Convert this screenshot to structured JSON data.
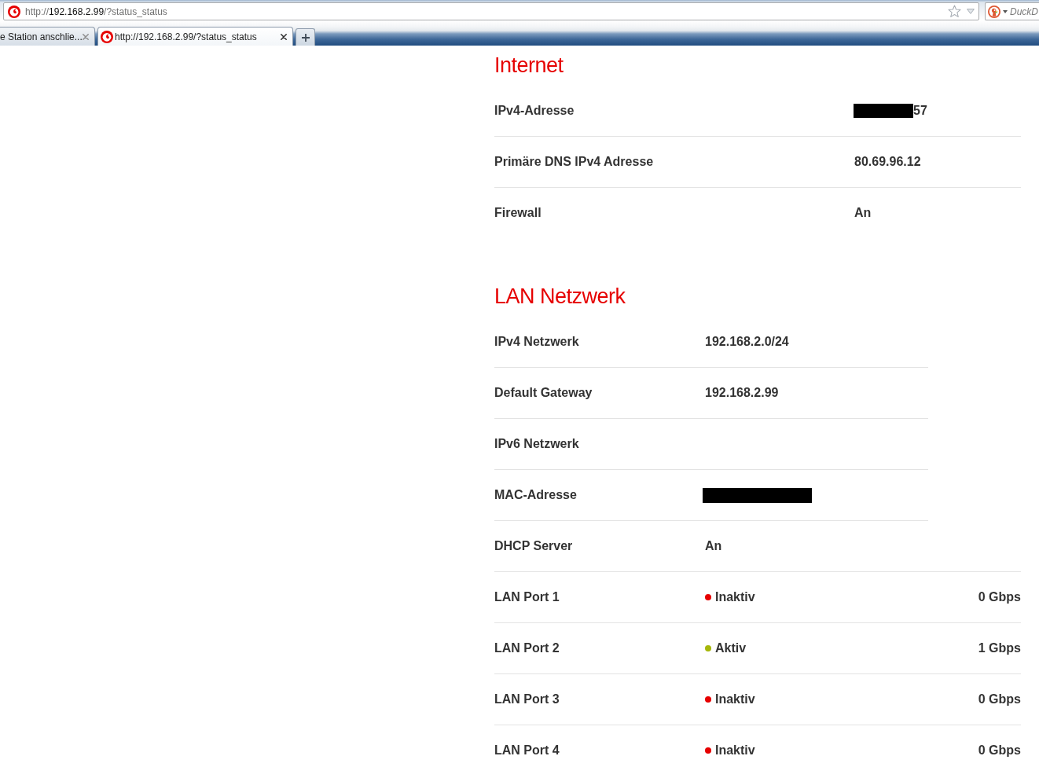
{
  "browser": {
    "address_bar": {
      "url": {
        "scheme": "http://",
        "host": "192.168.2.99",
        "path": "/?status_status"
      }
    },
    "search_field": {
      "placeholder": "DuckD"
    },
    "tabs": [
      {
        "title": "e Station anschlie...",
        "selected": false,
        "favicon": false
      },
      {
        "title": "http://192.168.2.99/?status_status",
        "selected": true,
        "favicon": true
      }
    ]
  },
  "sections": [
    {
      "title": "Internet",
      "rows": [
        {
          "kind": "field",
          "label": "IPv4-Adresse",
          "value": "57",
          "redacted": true
        },
        {
          "kind": "field",
          "label": "Primäre DNS IPv4 Adresse",
          "value": "80.69.96.12",
          "redacted": false
        },
        {
          "kind": "field",
          "label": "Firewall",
          "value": "An",
          "redacted": false
        }
      ]
    },
    {
      "title": "LAN Netzwerk",
      "rows": [
        {
          "kind": "field",
          "label": "IPv4 Netzwerk",
          "value": "192.168.2.0/24",
          "redacted": false
        },
        {
          "kind": "field",
          "label": "Default Gateway",
          "value": "192.168.2.99",
          "redacted": false
        },
        {
          "kind": "field",
          "label": "IPv6 Netzwerk",
          "redacted": false
        },
        {
          "kind": "field",
          "label": "MAC-Adresse",
          "redacted": true
        },
        {
          "kind": "field",
          "label": "DHCP Server",
          "value": "An",
          "redacted": false
        },
        {
          "kind": "port",
          "label": "LAN Port 1",
          "status": "Inaktiv",
          "color": "#e60000",
          "speed": "0 Gbps"
        },
        {
          "kind": "port",
          "label": "LAN Port 2",
          "status": "Aktiv",
          "color": "#a6b70a",
          "speed": "1 Gbps"
        },
        {
          "kind": "port",
          "label": "LAN Port 3",
          "status": "Inaktiv",
          "color": "#e60000",
          "speed": "0 Gbps"
        },
        {
          "kind": "port",
          "label": "LAN Port 4",
          "status": "Inaktiv",
          "color": "#e60000",
          "speed": "0 Gbps"
        }
      ]
    }
  ]
}
